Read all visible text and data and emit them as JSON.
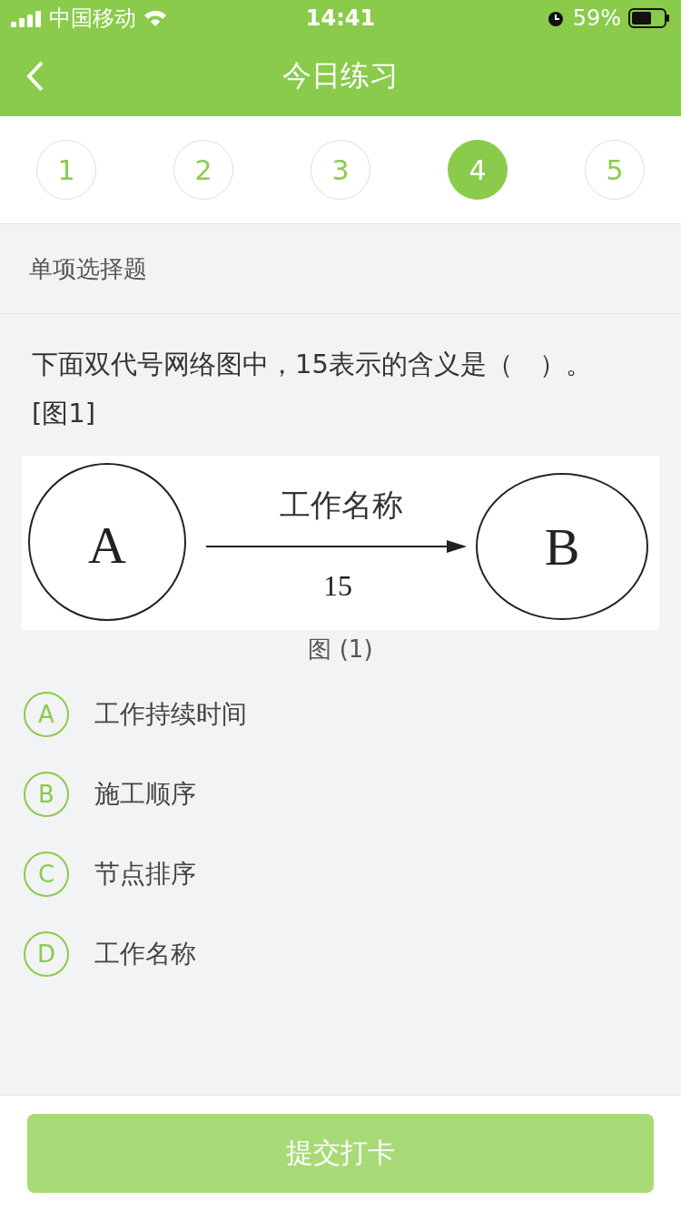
{
  "status_bar": {
    "carrier": "中国移动",
    "time": "14:41",
    "battery": "59%"
  },
  "header": {
    "title": "今日练习"
  },
  "question_nav": [
    {
      "label": "1",
      "selected": false
    },
    {
      "label": "2",
      "selected": false
    },
    {
      "label": "3",
      "selected": false
    },
    {
      "label": "4",
      "selected": true
    },
    {
      "label": "5",
      "selected": false
    }
  ],
  "section": {
    "title": "单项选择题"
  },
  "question": {
    "text": "下面双代号网络图中，15表示的含义是（　）。",
    "figure_ref": "[图1]",
    "diagram": {
      "node_a": "A",
      "node_b": "B",
      "arrow_label": "工作名称",
      "arrow_value": "15"
    },
    "caption": "图 (1)"
  },
  "options": [
    {
      "letter": "A",
      "text": "工作持续时间",
      "selected": false
    },
    {
      "letter": "B",
      "text": "施工顺序",
      "selected": false
    },
    {
      "letter": "C",
      "text": "节点排序",
      "selected": false
    },
    {
      "letter": "D",
      "text": "工作名称",
      "selected": false
    }
  ],
  "submit": {
    "label": "提交打卡",
    "disabled": true
  }
}
